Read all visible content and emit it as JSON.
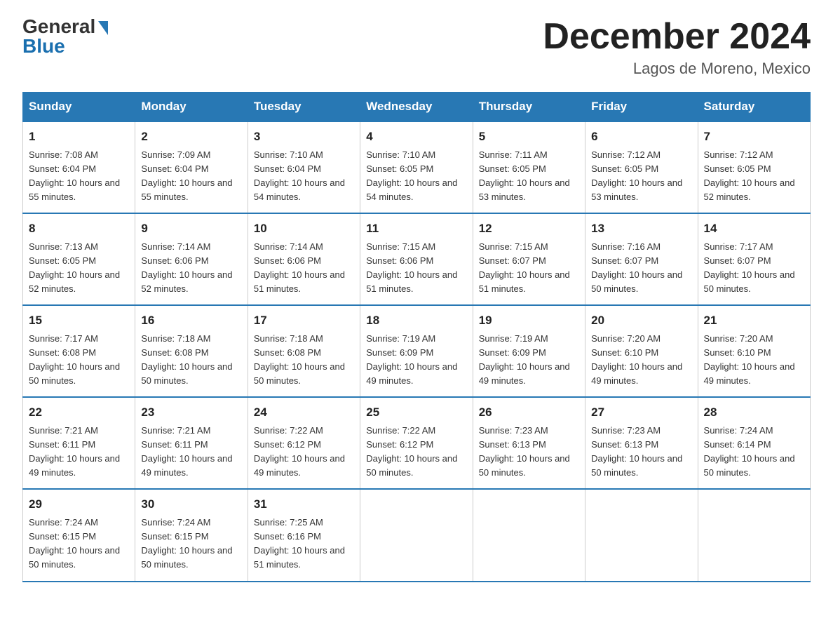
{
  "logo": {
    "general": "General",
    "blue": "Blue"
  },
  "title": "December 2024",
  "location": "Lagos de Moreno, Mexico",
  "days_of_week": [
    "Sunday",
    "Monday",
    "Tuesday",
    "Wednesday",
    "Thursday",
    "Friday",
    "Saturday"
  ],
  "weeks": [
    [
      {
        "day": "1",
        "sunrise": "7:08 AM",
        "sunset": "6:04 PM",
        "daylight": "10 hours and 55 minutes."
      },
      {
        "day": "2",
        "sunrise": "7:09 AM",
        "sunset": "6:04 PM",
        "daylight": "10 hours and 55 minutes."
      },
      {
        "day": "3",
        "sunrise": "7:10 AM",
        "sunset": "6:04 PM",
        "daylight": "10 hours and 54 minutes."
      },
      {
        "day": "4",
        "sunrise": "7:10 AM",
        "sunset": "6:05 PM",
        "daylight": "10 hours and 54 minutes."
      },
      {
        "day": "5",
        "sunrise": "7:11 AM",
        "sunset": "6:05 PM",
        "daylight": "10 hours and 53 minutes."
      },
      {
        "day": "6",
        "sunrise": "7:12 AM",
        "sunset": "6:05 PM",
        "daylight": "10 hours and 53 minutes."
      },
      {
        "day": "7",
        "sunrise": "7:12 AM",
        "sunset": "6:05 PM",
        "daylight": "10 hours and 52 minutes."
      }
    ],
    [
      {
        "day": "8",
        "sunrise": "7:13 AM",
        "sunset": "6:05 PM",
        "daylight": "10 hours and 52 minutes."
      },
      {
        "day": "9",
        "sunrise": "7:14 AM",
        "sunset": "6:06 PM",
        "daylight": "10 hours and 52 minutes."
      },
      {
        "day": "10",
        "sunrise": "7:14 AM",
        "sunset": "6:06 PM",
        "daylight": "10 hours and 51 minutes."
      },
      {
        "day": "11",
        "sunrise": "7:15 AM",
        "sunset": "6:06 PM",
        "daylight": "10 hours and 51 minutes."
      },
      {
        "day": "12",
        "sunrise": "7:15 AM",
        "sunset": "6:07 PM",
        "daylight": "10 hours and 51 minutes."
      },
      {
        "day": "13",
        "sunrise": "7:16 AM",
        "sunset": "6:07 PM",
        "daylight": "10 hours and 50 minutes."
      },
      {
        "day": "14",
        "sunrise": "7:17 AM",
        "sunset": "6:07 PM",
        "daylight": "10 hours and 50 minutes."
      }
    ],
    [
      {
        "day": "15",
        "sunrise": "7:17 AM",
        "sunset": "6:08 PM",
        "daylight": "10 hours and 50 minutes."
      },
      {
        "day": "16",
        "sunrise": "7:18 AM",
        "sunset": "6:08 PM",
        "daylight": "10 hours and 50 minutes."
      },
      {
        "day": "17",
        "sunrise": "7:18 AM",
        "sunset": "6:08 PM",
        "daylight": "10 hours and 50 minutes."
      },
      {
        "day": "18",
        "sunrise": "7:19 AM",
        "sunset": "6:09 PM",
        "daylight": "10 hours and 49 minutes."
      },
      {
        "day": "19",
        "sunrise": "7:19 AM",
        "sunset": "6:09 PM",
        "daylight": "10 hours and 49 minutes."
      },
      {
        "day": "20",
        "sunrise": "7:20 AM",
        "sunset": "6:10 PM",
        "daylight": "10 hours and 49 minutes."
      },
      {
        "day": "21",
        "sunrise": "7:20 AM",
        "sunset": "6:10 PM",
        "daylight": "10 hours and 49 minutes."
      }
    ],
    [
      {
        "day": "22",
        "sunrise": "7:21 AM",
        "sunset": "6:11 PM",
        "daylight": "10 hours and 49 minutes."
      },
      {
        "day": "23",
        "sunrise": "7:21 AM",
        "sunset": "6:11 PM",
        "daylight": "10 hours and 49 minutes."
      },
      {
        "day": "24",
        "sunrise": "7:22 AM",
        "sunset": "6:12 PM",
        "daylight": "10 hours and 49 minutes."
      },
      {
        "day": "25",
        "sunrise": "7:22 AM",
        "sunset": "6:12 PM",
        "daylight": "10 hours and 50 minutes."
      },
      {
        "day": "26",
        "sunrise": "7:23 AM",
        "sunset": "6:13 PM",
        "daylight": "10 hours and 50 minutes."
      },
      {
        "day": "27",
        "sunrise": "7:23 AM",
        "sunset": "6:13 PM",
        "daylight": "10 hours and 50 minutes."
      },
      {
        "day": "28",
        "sunrise": "7:24 AM",
        "sunset": "6:14 PM",
        "daylight": "10 hours and 50 minutes."
      }
    ],
    [
      {
        "day": "29",
        "sunrise": "7:24 AM",
        "sunset": "6:15 PM",
        "daylight": "10 hours and 50 minutes."
      },
      {
        "day": "30",
        "sunrise": "7:24 AM",
        "sunset": "6:15 PM",
        "daylight": "10 hours and 50 minutes."
      },
      {
        "day": "31",
        "sunrise": "7:25 AM",
        "sunset": "6:16 PM",
        "daylight": "10 hours and 51 minutes."
      },
      null,
      null,
      null,
      null
    ]
  ]
}
